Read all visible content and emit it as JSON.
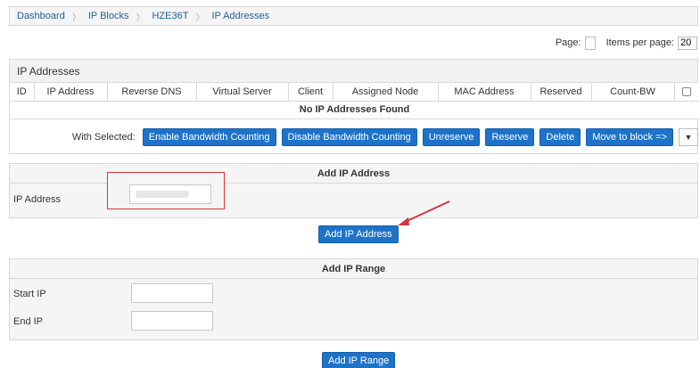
{
  "breadcrumb": {
    "items": [
      "Dashboard",
      "IP Blocks",
      "HZE36T",
      "IP Addresses"
    ]
  },
  "pager": {
    "page_label": "Page:",
    "page_value": "",
    "items_label": "Items per page:",
    "items_value": "20"
  },
  "ip_panel": {
    "title": "IP Addresses",
    "columns": [
      "ID",
      "IP Address",
      "Reverse DNS",
      "Virtual Server",
      "Client",
      "Assigned Node",
      "MAC Address",
      "Reserved",
      "Count-BW"
    ],
    "empty_message": "No IP Addresses Found"
  },
  "with_selected": {
    "label": "With Selected:",
    "buttons": [
      "Enable Bandwidth Counting",
      "Disable Bandwidth Counting",
      "Unreserve",
      "Reserve",
      "Delete",
      "Move to block =>"
    ],
    "select_icon": "chevron-down-icon"
  },
  "add_ip": {
    "title": "Add IP Address",
    "label": "IP Address",
    "value": "",
    "button": "Add IP Address"
  },
  "add_range": {
    "title": "Add IP Range",
    "start_label": "Start IP",
    "end_label": "End IP",
    "start_value": "",
    "end_value": "",
    "button": "Add IP Range"
  },
  "colors": {
    "accent": "#1e73c9",
    "highlight": "#d9343a",
    "link": "#1f5f98"
  }
}
